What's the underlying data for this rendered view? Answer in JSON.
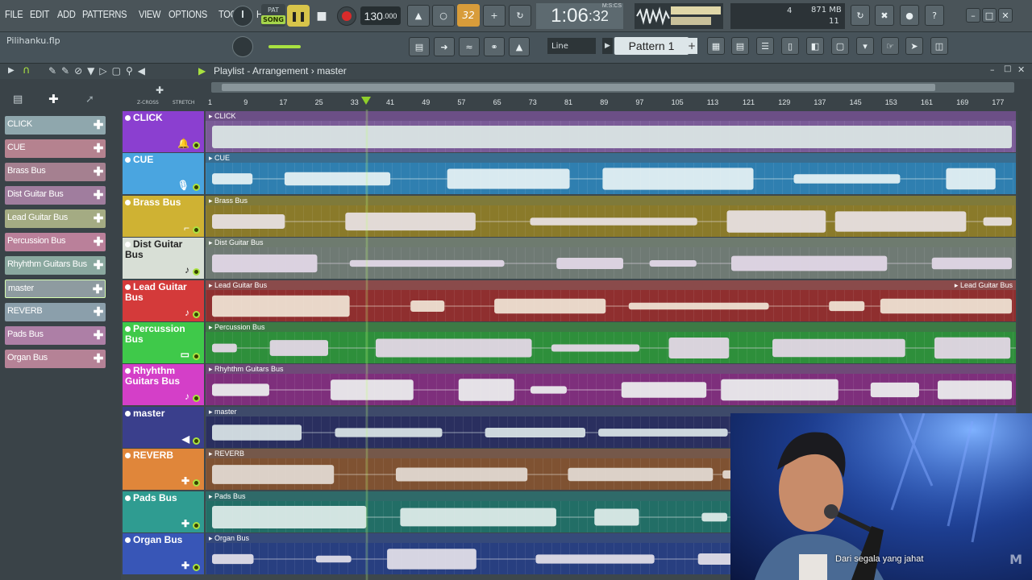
{
  "menu": [
    "FILE",
    "EDIT",
    "ADD",
    "PATTERNS",
    "VIEW",
    "OPTIONS",
    "TOOLS",
    "HELP"
  ],
  "transport": {
    "mode_top": "PAT",
    "mode_label": "SONG",
    "tempo_int": "130",
    "tempo_dec": ".000",
    "time_main": "1:06",
    "time_sub": ":32",
    "time_unit": "M:S:CS",
    "numerator": "32"
  },
  "cpu": {
    "value": "4",
    "ram": "871 MB",
    "polyphony": "11"
  },
  "file": {
    "name": "Pilihanku.flp"
  },
  "snap": {
    "value": "Line"
  },
  "pattern": {
    "label": "Pattern 1"
  },
  "playlist": {
    "title": "Playlist - Arrangement",
    "sep": "›",
    "target": "master",
    "ruler_labels": {
      "zcross": "Z-CROSS",
      "stretch": "STRETCH"
    }
  },
  "bars": [
    "1",
    "9",
    "17",
    "25",
    "33",
    "41",
    "49",
    "57",
    "65",
    "73",
    "81",
    "89",
    "97",
    "105",
    "113",
    "121",
    "129",
    "137",
    "145",
    "153",
    "161",
    "169",
    "177"
  ],
  "picker": [
    {
      "label": "CLICK",
      "color": "#8fa7ad"
    },
    {
      "label": "CUE",
      "color": "#b5828f"
    },
    {
      "label": "Brass Bus",
      "color": "#a58090"
    },
    {
      "label": "Dist Guitar Bus",
      "color": "#a07d9e"
    },
    {
      "label": "Lead Guitar Bus",
      "color": "#a4ab83"
    },
    {
      "label": "Percussion Bus",
      "color": "#ba809a"
    },
    {
      "label": "Rhyhthm Guitars Bus",
      "color": "#8aa89f"
    },
    {
      "label": "master",
      "color": "#8e9ba0",
      "selected": true
    },
    {
      "label": "REVERB",
      "color": "#8b9fab"
    },
    {
      "label": "Pads Bus",
      "color": "#ad7fa6"
    },
    {
      "label": "Organ Bus",
      "color": "#b58296"
    }
  ],
  "tracks": [
    {
      "name": "CLICK",
      "clip": "CLICK",
      "head": "#8b3fd0",
      "lane": "#7a5b97",
      "title_bg": "#6c4f86",
      "wave": "#dce8e6",
      "icon": "bell-icon"
    },
    {
      "name": "CUE",
      "clip": "CUE",
      "head": "#4aa5e0",
      "lane": "#2f7fb0",
      "title_bg": "#3a6d8f",
      "wave": "#e8f3f5",
      "icon": "mic-icon"
    },
    {
      "name": "Brass Bus",
      "clip": "Brass Bus",
      "head": "#cfb233",
      "lane": "#8a7a2a",
      "title_bg": "#7f7a3a",
      "wave": "#e9e2e5",
      "icon": "trumpet-icon"
    },
    {
      "name": "Dist Guitar Bus",
      "clip": "Dist Guitar Bus",
      "head": "#d8dfd6",
      "lane": "#6f7a74",
      "title_bg": "#6e7b6f",
      "wave": "#e4d9e9",
      "icon": "guitar-icon",
      "dark": true
    },
    {
      "name": "Lead Guitar Bus",
      "clip": "Lead Guitar Bus",
      "clip_right": "Lead Guitar Bus",
      "head": "#d43a3a",
      "lane": "#8f2f2f",
      "title_bg": "#8a4b4b",
      "wave": "#f1e6d7",
      "icon": "guitar-icon"
    },
    {
      "name": "Percussion Bus",
      "clip": "Percussion Bus",
      "head": "#3fc94a",
      "lane": "#2e8f3b",
      "title_bg": "#3d7a45",
      "wave": "#e8d9ea",
      "icon": "drums-icon"
    },
    {
      "name": "Rhyhthm Guitars Bus",
      "clip": "Rhyhthm Guitars Bus",
      "head": "#d43fc8",
      "lane": "#7e2f7c",
      "title_bg": "#6f4a78",
      "wave": "#eef1f0",
      "icon": "guitar-icon"
    },
    {
      "name": "master",
      "clip": "master",
      "head": "#3a3f8c",
      "lane": "#2a2f5f",
      "title_bg": "#3e4a6a",
      "wave": "#dbe6e8",
      "icon": "speaker-icon"
    },
    {
      "name": "REVERB",
      "clip": "REVERB",
      "head": "#e0863a",
      "lane": "#7f5232",
      "title_bg": "#75584a",
      "wave": "#e4dcd5",
      "icon": "plus-icon"
    },
    {
      "name": "Pads Bus",
      "clip": "Pads Bus",
      "head": "#2f9c91",
      "lane": "#226e66",
      "title_bg": "#2f6a69",
      "wave": "#e2eeec",
      "icon": "plus-icon"
    },
    {
      "name": "Organ Bus",
      "clip": "Organ Bus",
      "head": "#3856b7",
      "lane": "#283f80",
      "title_bg": "#364a7a",
      "wave": "#e5e2ea",
      "icon": "plus-icon"
    }
  ],
  "video": {
    "caption": "Dari segala yang jahat",
    "logo": "M"
  }
}
